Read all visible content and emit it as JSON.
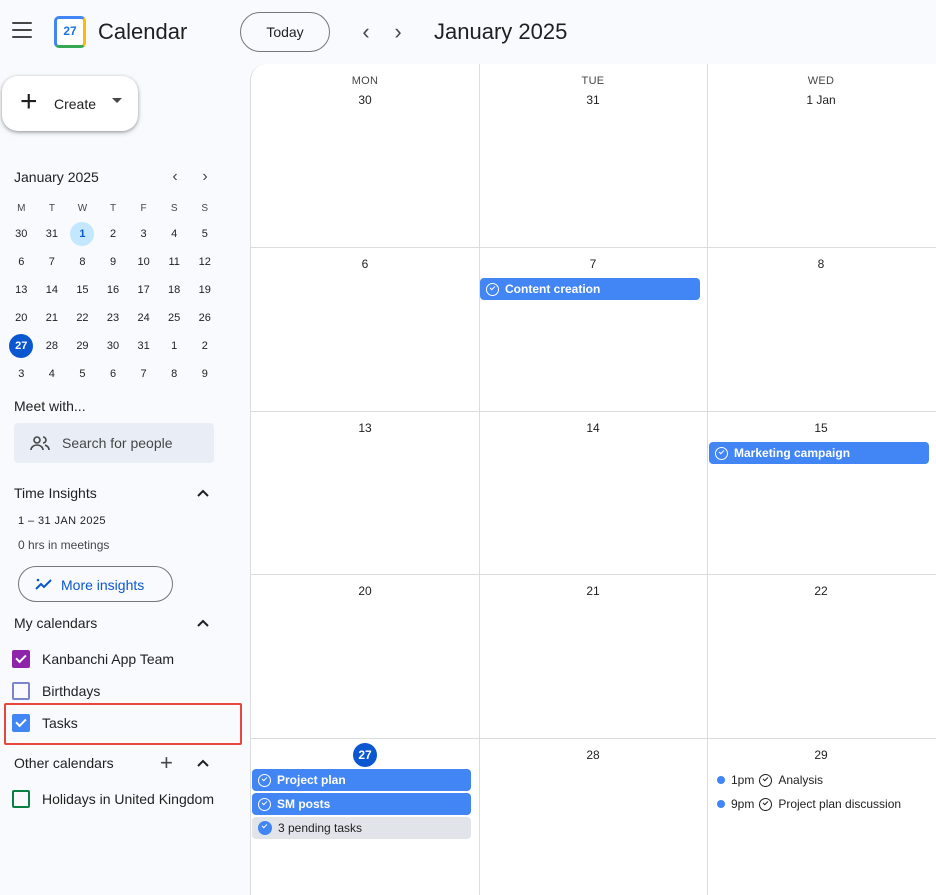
{
  "app": {
    "title": "Calendar",
    "logo_day": "27"
  },
  "toolbar": {
    "today_label": "Today",
    "month_title": "January 2025"
  },
  "sidebar": {
    "create_label": "Create",
    "mini_calendar": {
      "title": "January 2025",
      "weekdays": [
        "M",
        "T",
        "W",
        "T",
        "F",
        "S",
        "S"
      ],
      "weeks": [
        [
          "30",
          "31",
          "1",
          "2",
          "3",
          "4",
          "5"
        ],
        [
          "6",
          "7",
          "8",
          "9",
          "10",
          "11",
          "12"
        ],
        [
          "13",
          "14",
          "15",
          "16",
          "17",
          "18",
          "19"
        ],
        [
          "20",
          "21",
          "22",
          "23",
          "24",
          "25",
          "26"
        ],
        [
          "27",
          "28",
          "29",
          "30",
          "31",
          "1",
          "2"
        ],
        [
          "3",
          "4",
          "5",
          "6",
          "7",
          "8",
          "9"
        ]
      ]
    },
    "meet_with": {
      "title": "Meet with...",
      "placeholder": "Search for people"
    },
    "time_insights": {
      "title": "Time Insights",
      "range": "1 – 31 JAN 2025",
      "meetings": "0 hrs in meetings",
      "more_label": "More insights"
    },
    "my_calendars": {
      "title": "My calendars",
      "items": [
        {
          "label": "Kanbanchi App Team",
          "checked": true,
          "color": "#8e24aa"
        },
        {
          "label": "Birthdays",
          "checked": false,
          "color": "#7986cb"
        },
        {
          "label": "Tasks",
          "checked": true,
          "color": "#4285f4"
        }
      ]
    },
    "other_calendars": {
      "title": "Other calendars",
      "items": [
        {
          "label": "Holidays in United Kingdom",
          "checked": false,
          "color": "#0b8043"
        }
      ]
    }
  },
  "grid": {
    "weekdays": [
      "MON",
      "TUE",
      "WED"
    ],
    "weeks": [
      {
        "days": [
          "30",
          "31",
          "1 Jan"
        ]
      },
      {
        "days": [
          "6",
          "7",
          "8"
        ]
      },
      {
        "days": [
          "13",
          "14",
          "15"
        ]
      },
      {
        "days": [
          "20",
          "21",
          "22"
        ]
      },
      {
        "days": [
          "27",
          "28",
          "29"
        ]
      }
    ],
    "events": {
      "content_creation": "Content creation",
      "marketing_campaign": "Marketing campaign",
      "project_plan": "Project plan",
      "sm_posts": "SM posts",
      "pending": "3 pending tasks",
      "analysis_time": "1pm",
      "analysis_title": "Analysis",
      "discussion_time": "9pm",
      "discussion_title": "Project plan discussion"
    }
  },
  "colors": {
    "accent": "#0b57d0",
    "event": "#4285f4",
    "highlight": "#e8453c"
  }
}
